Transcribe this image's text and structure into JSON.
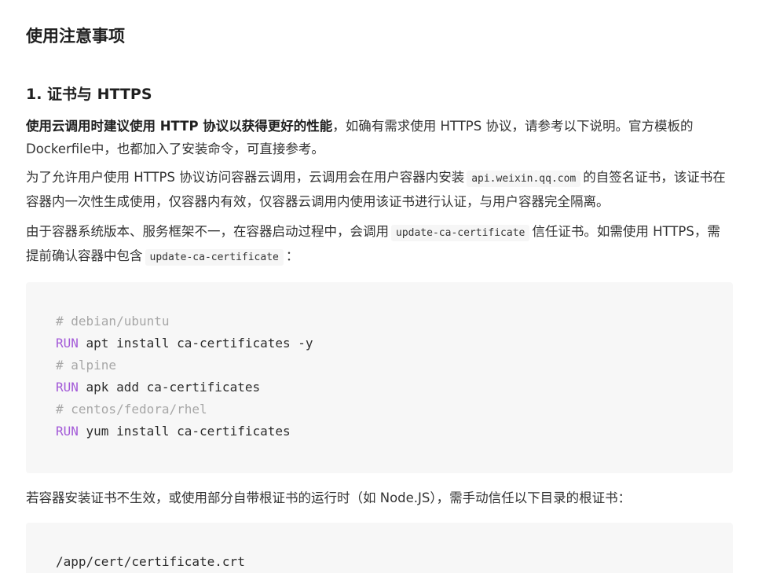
{
  "heading": "使用注意事项",
  "section1": {
    "title": "1. 证书与 HTTPS",
    "p1": {
      "bold": "使用云调用时建议使用 HTTP 协议以获得更好的性能",
      "rest": "，如确有需求使用 HTTPS 协议，请参考以下说明。官方模板的Dockerfile中，也都加入了安装命令，可直接参考。"
    },
    "p2": {
      "before": "为了允许用户使用 HTTPS 协议访问容器云调用，云调用会在用户容器内安装",
      "code": "api.weixin.qq.com",
      "after": "的自签名证书，该证书在容器内一次性生成使用，仅容器内有效，仅容器云调用内使用该证书进行认证，与用户容器完全隔离。"
    },
    "p3": {
      "before": "由于容器系统版本、服务框架不一，在容器启动过程中，会调用",
      "code1": "update-ca-certificate",
      "middle": "信任证书。如需使用 HTTPS，需提前确认容器中包含",
      "code2": "update-ca-certificate",
      "after": "："
    },
    "code1": [
      {
        "comment": "# debian/ubuntu"
      },
      {
        "keyword": "RUN",
        "text": " apt install ca-certificates -y"
      },
      {
        "comment": "# alpine"
      },
      {
        "keyword": "RUN",
        "text": " apk add ca-certificates"
      },
      {
        "comment": "# centos/fedora/rhel"
      },
      {
        "keyword": "RUN",
        "text": " yum install ca-certificates"
      }
    ],
    "p4": "若容器安装证书不生效，或使用部分自带根证书的运行时（如 Node.JS），需手动信任以下目录的根证书：",
    "code2": "/app/cert/certificate.crt"
  },
  "colors": {
    "keyword": "#a35ad8",
    "comment": "#a7a7a7",
    "code_bg": "#f7f7f7"
  }
}
